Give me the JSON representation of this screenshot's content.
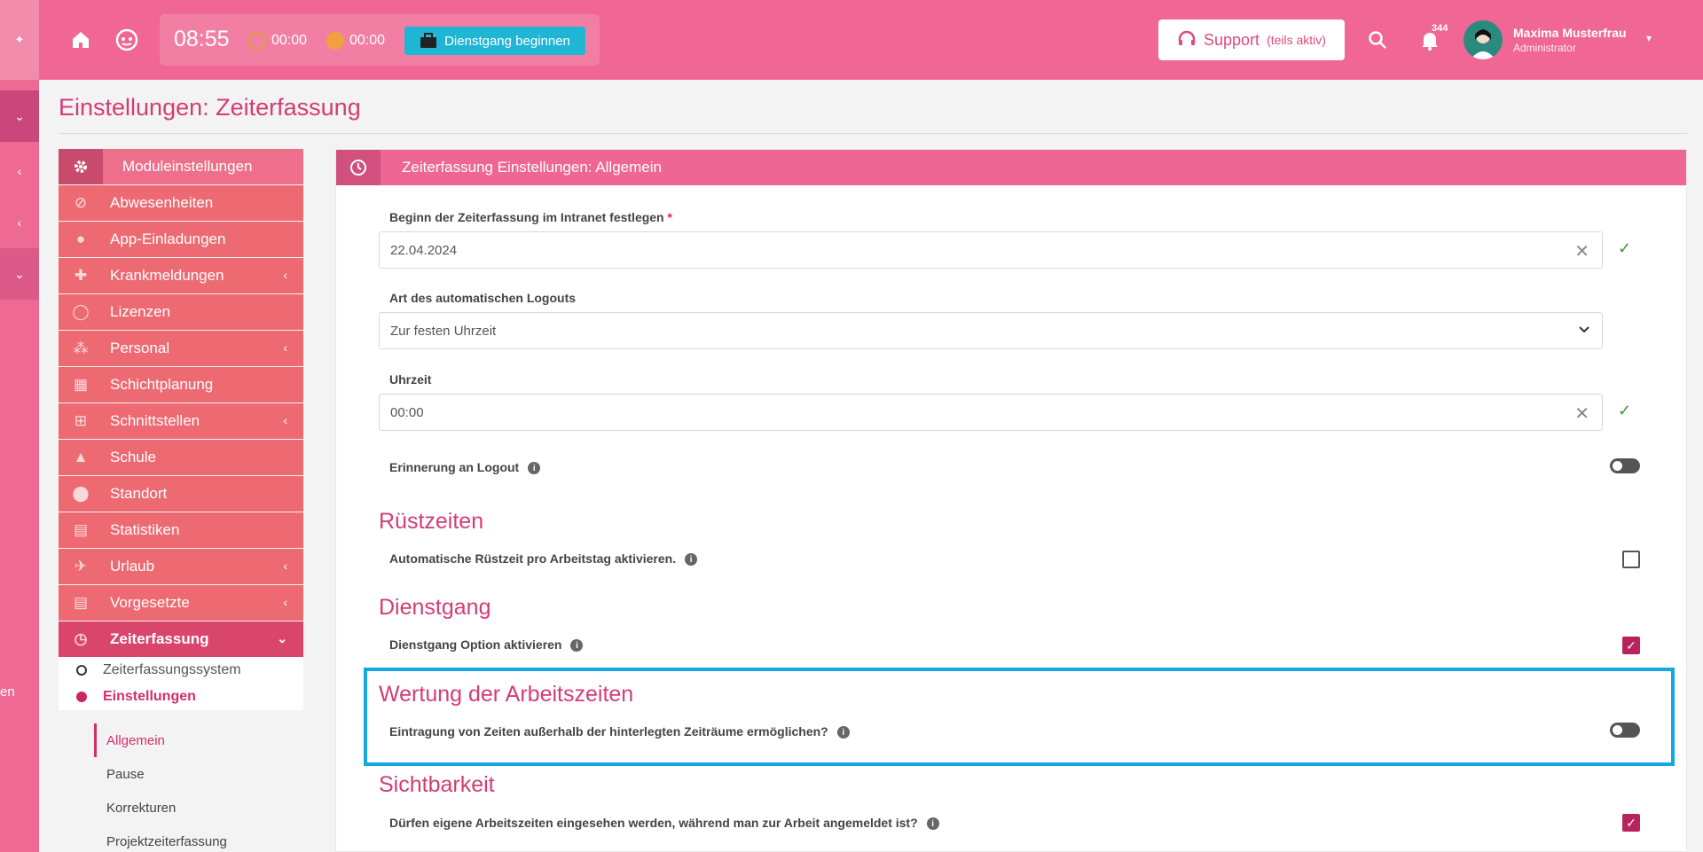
{
  "topbar": {
    "time": "08:55",
    "timer1": "00:00",
    "timer2": "00:00",
    "duty_button": "Dienstgang beginnen",
    "support_label": "Support",
    "support_status": "(teils aktiv)",
    "notification_count": "344",
    "user_name": "Maxima Musterfrau",
    "user_role": "Administrator"
  },
  "rail": {
    "side_text": "en"
  },
  "page": {
    "title": "Einstellungen: Zeiterfassung"
  },
  "menu": {
    "header": "Moduleinstellungen",
    "items": [
      {
        "label": "Abwesenheiten",
        "icon": "ban-icon"
      },
      {
        "label": "App-Einladungen",
        "icon": "person-icon"
      },
      {
        "label": "Krankmeldungen",
        "icon": "medical-icon"
      },
      {
        "label": "Lizenzen",
        "icon": "circle-icon"
      },
      {
        "label": "Personal",
        "icon": "group-icon"
      },
      {
        "label": "Schichtplanung",
        "icon": "table-icon"
      },
      {
        "label": "Schnittstellen",
        "icon": "hierarchy-icon"
      },
      {
        "label": "Schule",
        "icon": "graduation-icon"
      },
      {
        "label": "Standort",
        "icon": "pin-icon"
      },
      {
        "label": "Statistiken",
        "icon": "chart-icon"
      },
      {
        "label": "Urlaub",
        "icon": "plane-icon"
      },
      {
        "label": "Vorgesetzte",
        "icon": "chart-icon"
      },
      {
        "label": "Zeiterfassung",
        "icon": "clock-icon"
      }
    ],
    "sub_items": [
      "Zeiterfassungssystem",
      "Einstellungen"
    ],
    "sub_sub_items": [
      "Allgemein",
      "Pause",
      "Korrekturen",
      "Projektzeiterfassung"
    ]
  },
  "card": {
    "title": "Zeiterfassung Einstellungen: Allgemein",
    "start_label": "Beginn der Zeiterfassung im Intranet festlegen",
    "required_mark": "*",
    "start_value": "22.04.2024",
    "logout_type_label": "Art des automatischen Logouts",
    "logout_type_value": "Zur festen Uhrzeit",
    "time_label": "Uhrzeit",
    "time_value": "00:00",
    "reminder_label": "Erinnerung an Logout",
    "section_ruest": "Rüstzeiten",
    "ruest_label": "Automatische Rüstzeit pro Arbeitstag aktivieren.",
    "section_dienstgang": "Dienstgang",
    "dienstgang_label": "Dienstgang Option aktivieren",
    "section_wertung": "Wertung der Arbeitszeiten",
    "wertung_label": "Eintragung von Zeiten außerhalb der hinterlegten Zeiträume ermöglichen?",
    "section_sicht": "Sichtbarkeit",
    "sicht_label": "Dürfen eigene Arbeitszeiten eingesehen werden, während man zur Arbeit angemeldet ist?"
  },
  "colors": {
    "brand": "#f06694",
    "accent": "#d43c74",
    "highlight": "#13a8e0"
  }
}
